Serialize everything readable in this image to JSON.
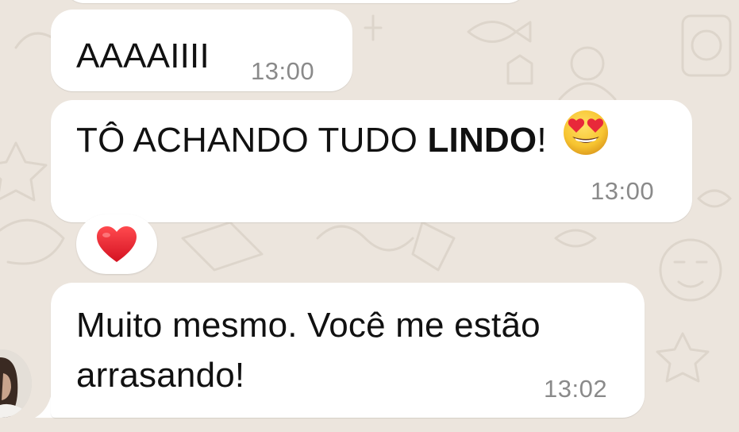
{
  "chat": {
    "messages": [
      {
        "text": "AAAAIIII",
        "time": "13:00"
      },
      {
        "text_before": "TÔ ACHANDO TUDO ",
        "text_bold": "LINDO",
        "text_after": "!",
        "emoji": "smiling-face-with-heart-eyes",
        "time": "13:00"
      },
      {
        "text": "Muito mesmo. Você me estão arrasando!",
        "time": "13:02"
      }
    ],
    "reaction": {
      "emoji": "red-heart"
    }
  },
  "colors": {
    "background": "#ece5dd",
    "bubble": "#ffffff",
    "timestamp": "#8a8a8a",
    "heart": "#e6232e",
    "emoji_face": "#f7c531"
  }
}
